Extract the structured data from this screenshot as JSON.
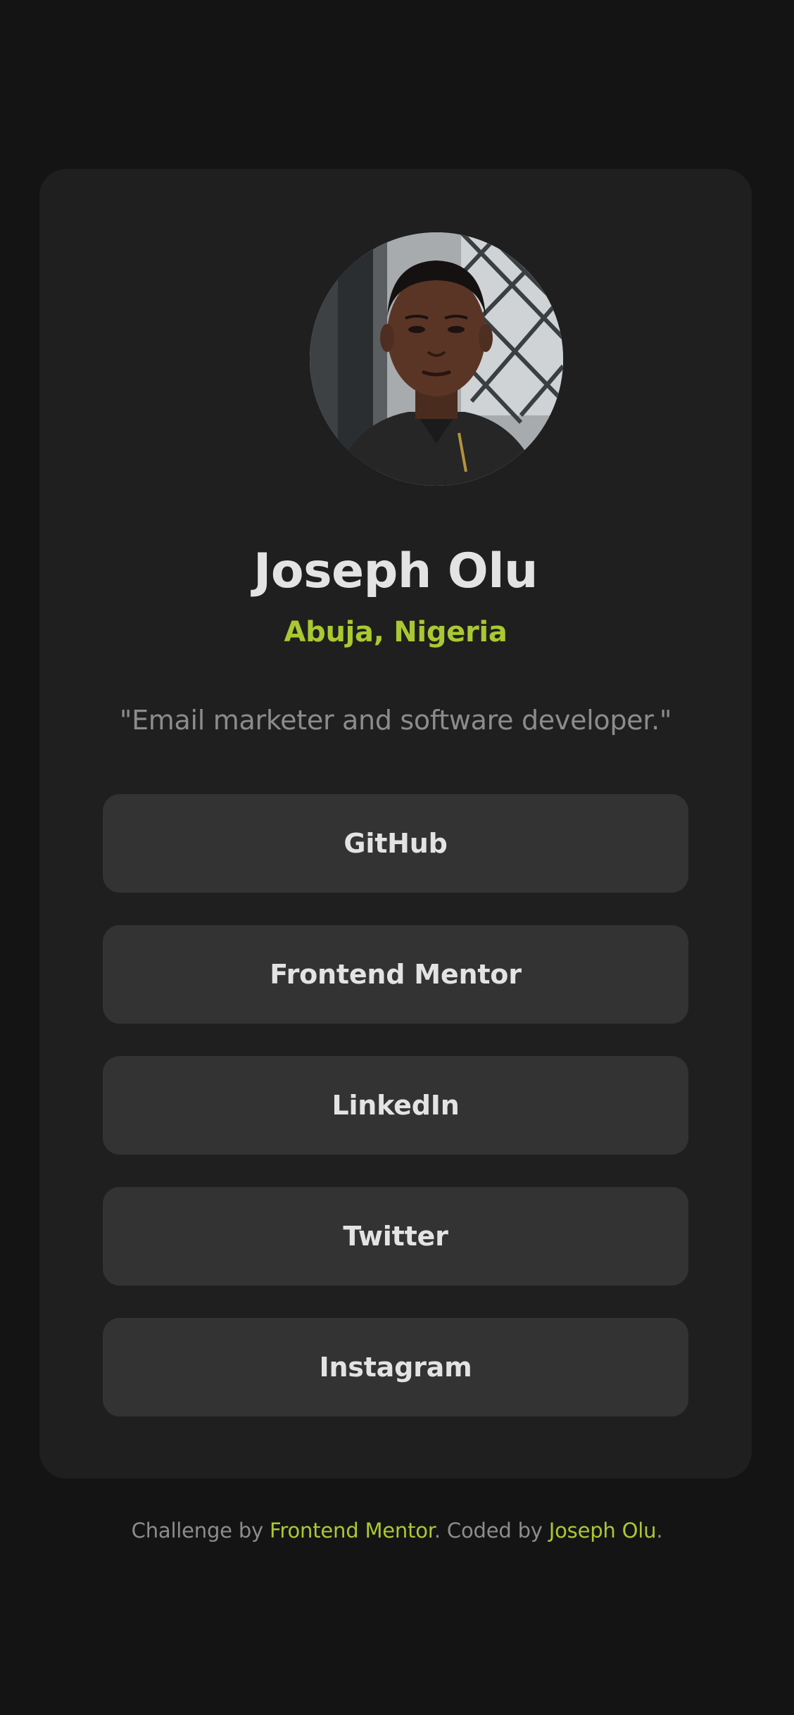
{
  "profile": {
    "avatar_alt": "Joseph Olu",
    "name": "Joseph Olu",
    "location": "Abuja, Nigeria",
    "bio": "\"Email marketer and software developer.\""
  },
  "links": [
    {
      "label": "GitHub"
    },
    {
      "label": "Frontend Mentor"
    },
    {
      "label": "LinkedIn"
    },
    {
      "label": "Twitter"
    },
    {
      "label": "Instagram"
    }
  ],
  "footer": {
    "prefix": "Challenge by ",
    "challenge_link": "Frontend Mentor",
    "middle": ". Coded by ",
    "author_link": "Joseph Olu",
    "suffix": "."
  },
  "colors": {
    "background": "#141414",
    "card": "#1f1f1f",
    "button": "#333333",
    "accent": "#a9c832",
    "text": "#e3e3e3",
    "muted": "#8c8c8c"
  }
}
